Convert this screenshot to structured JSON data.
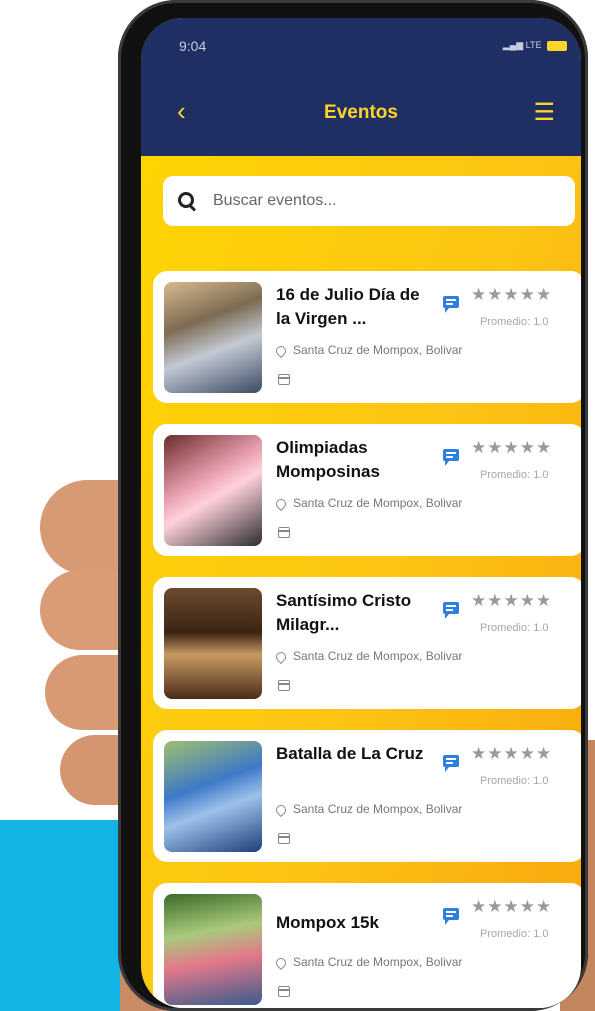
{
  "status_bar": {
    "time": "9:04",
    "network": "LTE"
  },
  "header": {
    "back_icon": "chevron-left-icon",
    "title": "Eventos",
    "menu_icon": "hamburger-menu-icon"
  },
  "search": {
    "placeholder": "Buscar eventos...",
    "value": ""
  },
  "colors": {
    "header_bg": "#1f2f63",
    "accent_yellow": "#ffd52a",
    "card_bg": "#ffffff",
    "chat_icon_blue": "#2d7fe0"
  },
  "events": [
    {
      "name": "16 de Julio Día de la Virgen ...",
      "stars": "★★★★★",
      "average": "Promedio: 1.0",
      "location": "Santa Cruz de Mompox, Bolivar"
    },
    {
      "name": "Olimpiadas Momposinas",
      "stars": "★★★★★",
      "average": "Promedio: 1.0",
      "location": "Santa Cruz de Mompox, Bolivar"
    },
    {
      "name": "Santísimo Cristo Milagr...",
      "stars": "★★★★★",
      "average": "Promedio: 1.0",
      "location": "Santa Cruz de Mompox, Bolivar"
    },
    {
      "name": "Batalla de La Cruz",
      "stars": "★★★★★",
      "average": "Promedio: 1.0",
      "location": "Santa Cruz de Mompox, Bolivar"
    },
    {
      "name": "Mompox 15k",
      "stars": "★★★★★",
      "average": "Promedio: 1.0",
      "location": "Santa Cruz de Mompox, Bolivar"
    }
  ]
}
